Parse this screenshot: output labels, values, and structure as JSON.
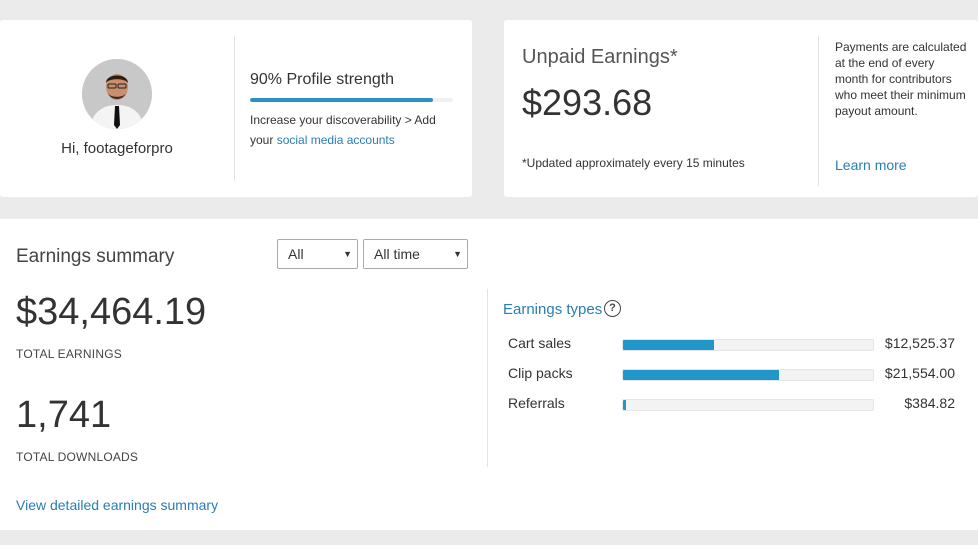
{
  "profile": {
    "greeting": "Hi, footageforpro",
    "strength_title": "90% Profile strength",
    "strength_fraction": 0.9,
    "message_prefix": "Increase your discoverability > Add your ",
    "message_link": "social media accounts"
  },
  "unpaid": {
    "title": "Unpaid Earnings*",
    "amount": "$293.68",
    "note": "*Updated approximately every 15 minutes",
    "payments_info": "Payments are calculated at the end of every month for contributors who meet their minimum payout amount.",
    "learn_more": "Learn more"
  },
  "summary": {
    "title": "Earnings summary",
    "filter_type": "All",
    "filter_time": "All time",
    "total_earnings": "$34,464.19",
    "total_earnings_label": "TOTAL EARNINGS",
    "total_downloads": "1,741",
    "total_downloads_label": "TOTAL DOWNLOADS",
    "detail_link": "View detailed earnings summary",
    "types_title": "Earnings types",
    "help_icon": "?",
    "types": [
      {
        "label": "Cart sales",
        "value": "$12,525.37",
        "fraction": 0.3634
      },
      {
        "label": "Clip packs",
        "value": "$21,554.00",
        "fraction": 0.6254
      },
      {
        "label": "Referrals",
        "value": "$384.82",
        "fraction": 0.0112
      }
    ]
  },
  "colors": {
    "accent": "#2196c9",
    "link": "#2a7eb4"
  },
  "icons": {
    "caret": "caret-down-icon",
    "help": "question-circle-icon"
  }
}
